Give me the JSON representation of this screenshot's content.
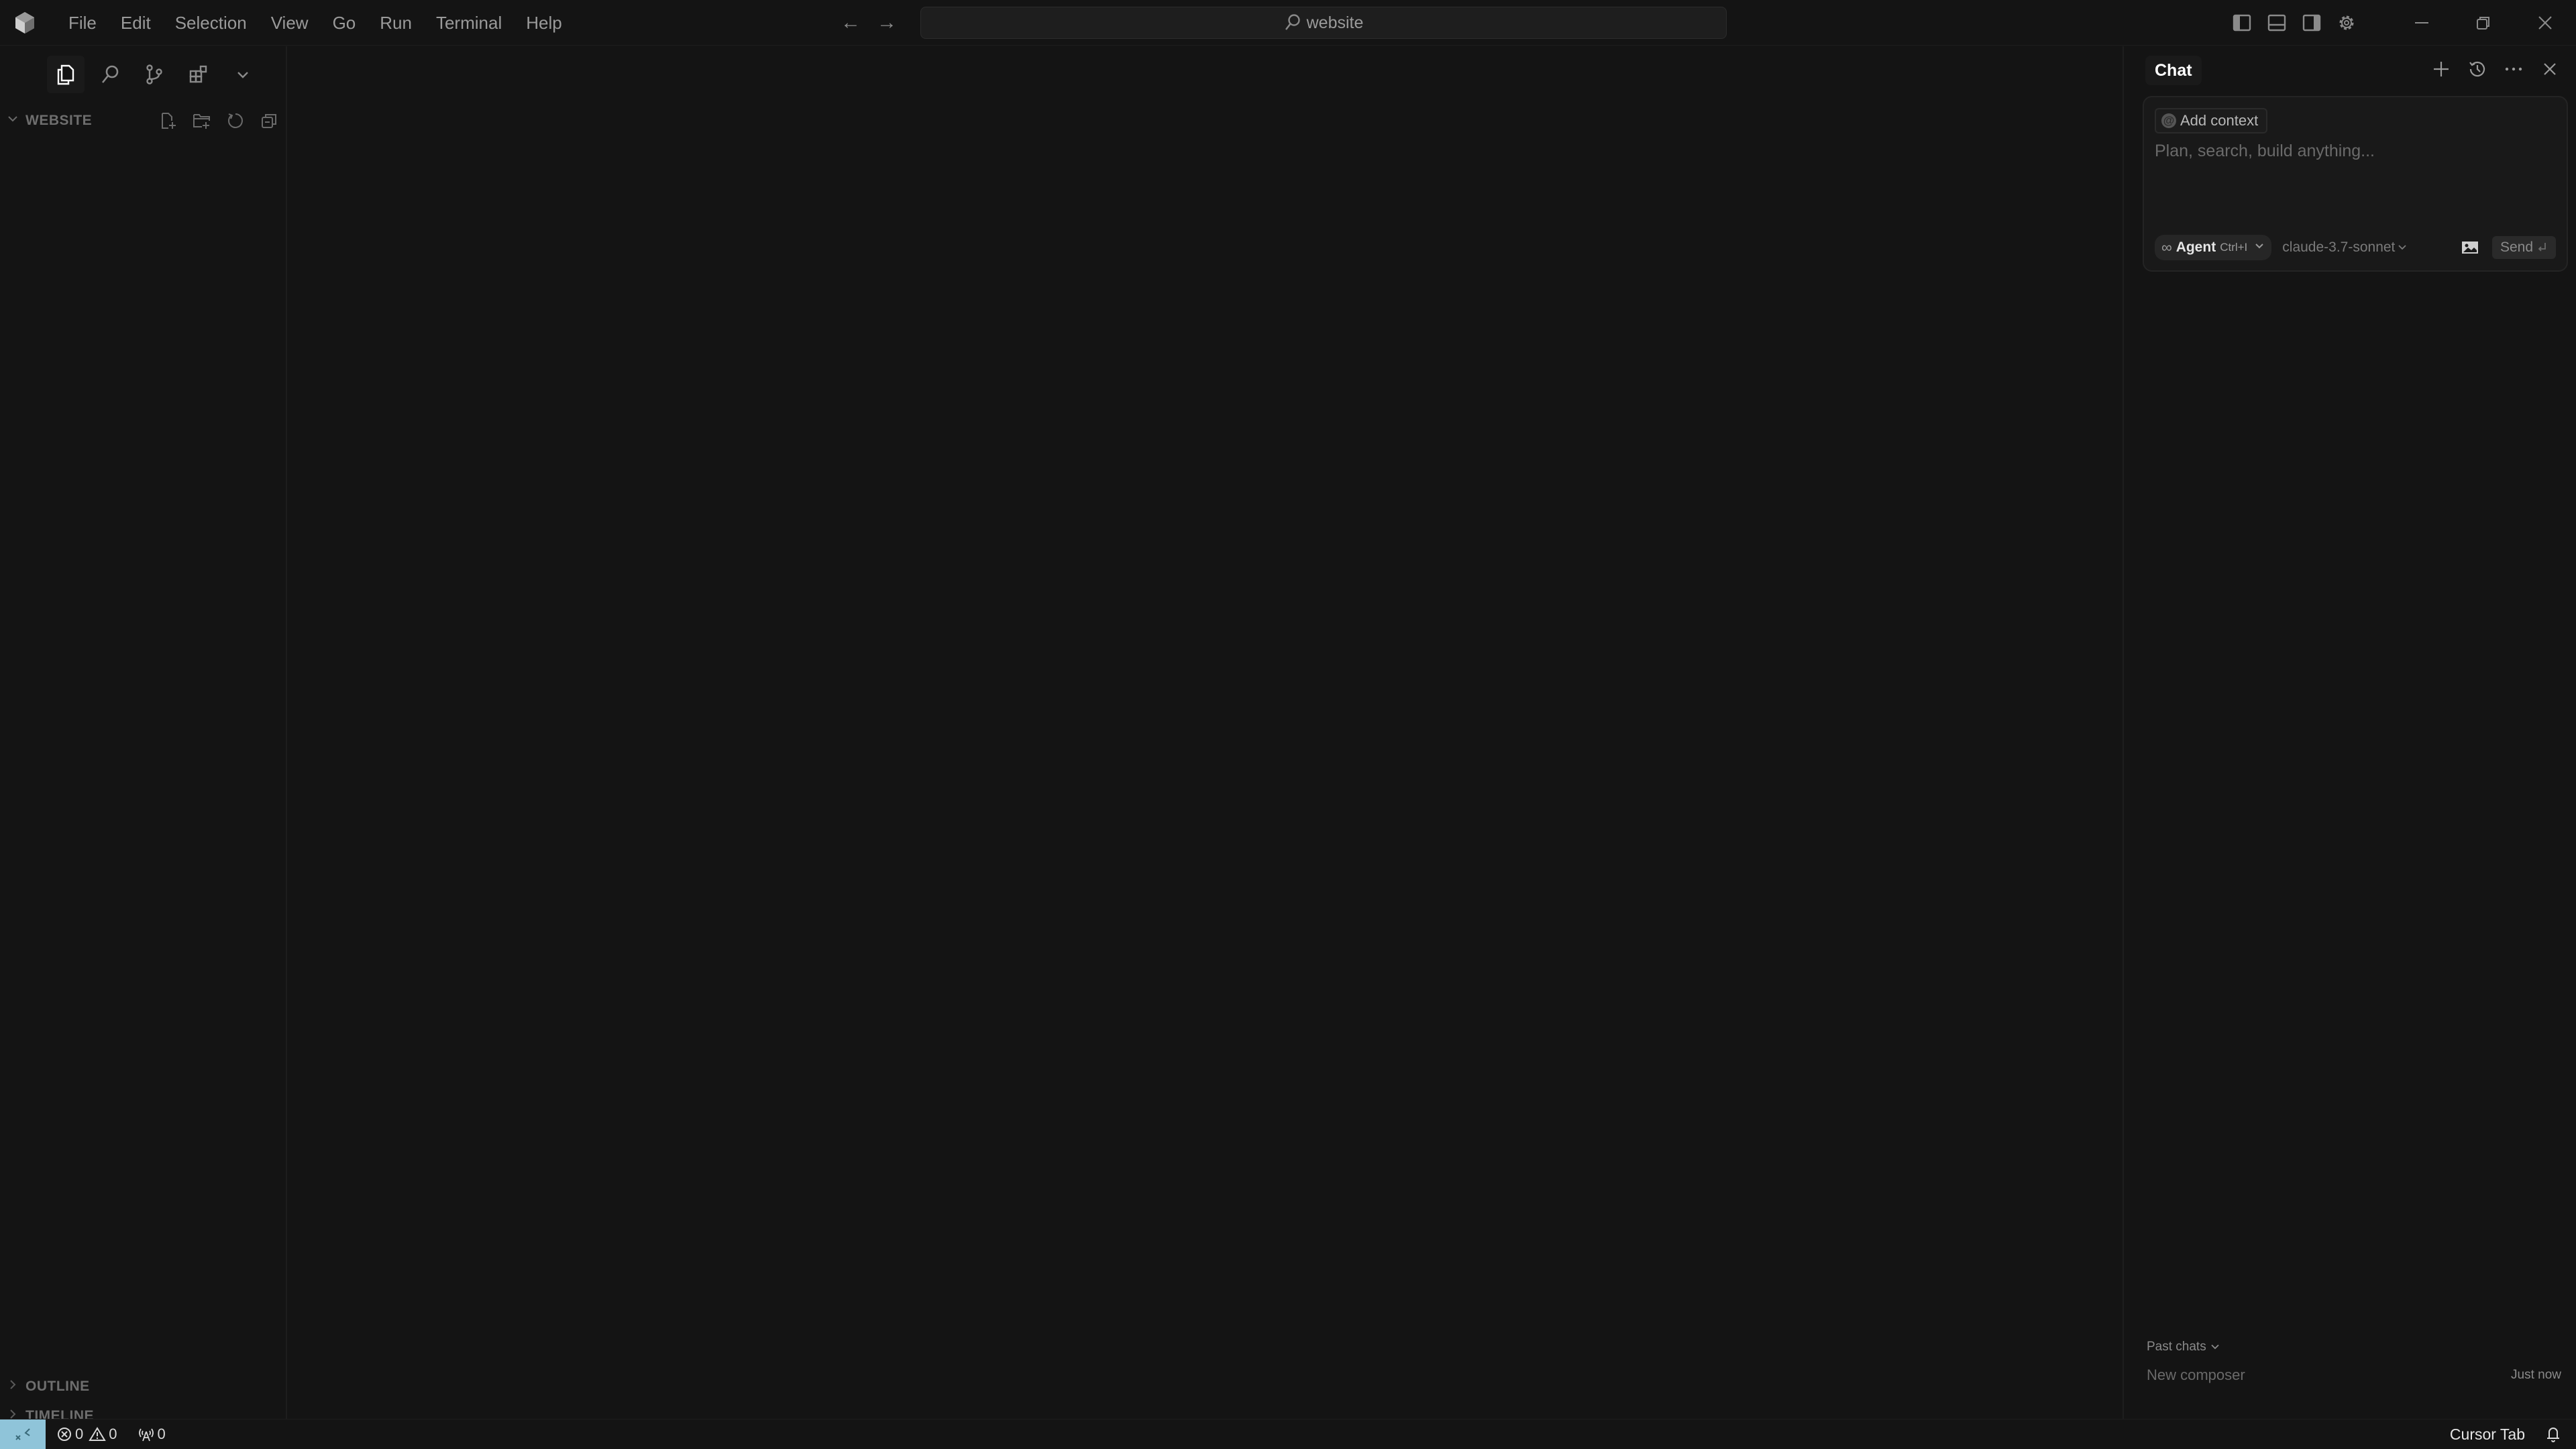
{
  "titlebar": {
    "menu": [
      "File",
      "Edit",
      "Selection",
      "View",
      "Go",
      "Run",
      "Terminal",
      "Help"
    ],
    "search_text": "website",
    "icons": [
      "back-arrow-icon",
      "forward-arrow-icon",
      "toggle-primary-sidebar-icon",
      "toggle-panel-icon",
      "toggle-secondary-sidebar-icon",
      "settings-gear-icon",
      "minimize-icon",
      "restore-icon",
      "close-icon"
    ]
  },
  "sidebar": {
    "activity_icons": [
      "explorer-icon",
      "search-icon",
      "source-control-icon",
      "extensions-icon",
      "more-views-chevron-icon"
    ],
    "explorer_title": "WEBSITE",
    "explorer_actions": [
      "new-file-icon",
      "new-folder-icon",
      "refresh-icon",
      "collapse-all-icon"
    ],
    "sections": [
      {
        "title": "OUTLINE"
      },
      {
        "title": "TIMELINE"
      }
    ]
  },
  "chat": {
    "tab_label": "Chat",
    "header_icons": [
      "new-chat-icon",
      "history-icon",
      "more-icon",
      "close-icon"
    ],
    "add_context_label": "Add context",
    "prompt_placeholder": "Plan, search, build anything...",
    "mode_label": "Agent",
    "mode_shortcut": "Ctrl+I",
    "model_label": "claude-3.7-sonnet",
    "send_label": "Send",
    "past_chats_label": "Past chats",
    "past_chats": [
      {
        "name": "New composer",
        "time": "Just now"
      }
    ]
  },
  "statusbar": {
    "errors": "0",
    "warnings": "0",
    "ports": "0",
    "cursor_tab_label": "Cursor Tab",
    "remote_color": "#8fc4d9"
  }
}
